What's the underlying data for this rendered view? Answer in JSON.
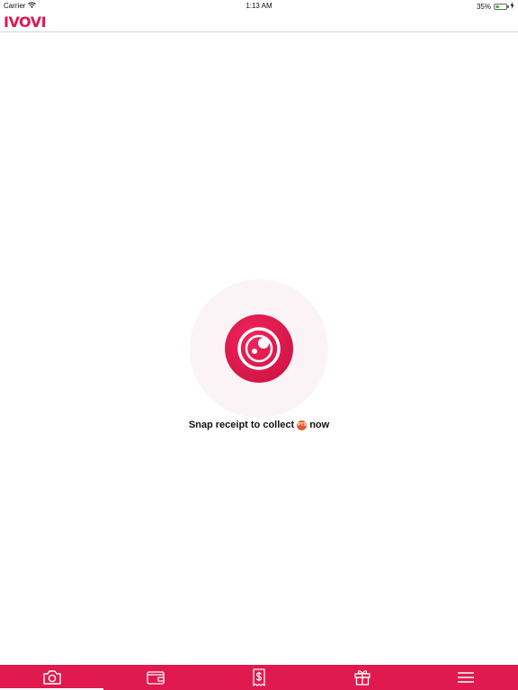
{
  "status_bar": {
    "carrier": "Carrier",
    "time": "1:13 AM",
    "battery_percent": "35%",
    "battery_level": 0.35,
    "wifi_icon": "wifi-icon",
    "charging_icon": "charging-bolt-icon"
  },
  "header": {
    "logo_text": "IVOVI",
    "divider_color": "#d8d8d8"
  },
  "main": {
    "snap_button_icon": "camera-lens-icon",
    "caption_before": "Snap receipt to collect",
    "coin_label": "PTS",
    "caption_after": "now"
  },
  "tab_bar": {
    "background_color": "#e0194f",
    "active_index": 0,
    "tabs": [
      {
        "icon": "camera-icon"
      },
      {
        "icon": "wallet-icon"
      },
      {
        "icon": "receipt-dollar-icon"
      },
      {
        "icon": "gift-icon"
      },
      {
        "icon": "menu-icon"
      }
    ]
  },
  "colors": {
    "brand": "#e0194f",
    "coin": "#e8572b"
  }
}
